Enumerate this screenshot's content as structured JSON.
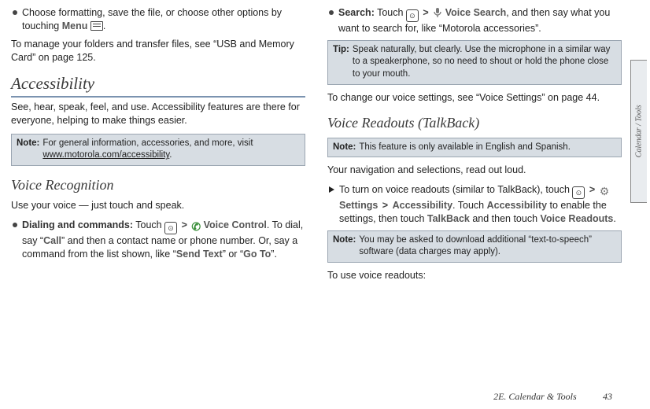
{
  "sideTab": "Calendar / Tools",
  "footer": {
    "section": "2E. Calendar & Tools",
    "page": "43"
  },
  "left": {
    "bullet1_a": "Choose formatting, save the file, or choose other options by touching ",
    "bullet1_menu": "Menu",
    "bullet1_b": ".",
    "para1": "To manage your folders and transfer files, see “USB and Memory Card” on page 125.",
    "h_access": "Accessibility",
    "access_intro": "See, hear, speak, feel, and use. Accessibility features are there for everyone, helping to make things easier.",
    "note1_label": "Note:",
    "note1_a": "For general information, accessories, and more, visit ",
    "note1_link": "www.motorola.com/accessibility",
    "note1_b": ".",
    "h_voice": "Voice Recognition",
    "voice_intro": "Use your voice — just touch and speak.",
    "dial_label": "Dialing and commands:",
    "dial_a": " Touch ",
    "dial_vc": "Voice Control",
    "dial_b": ". To dial, say “",
    "dial_call": "Call",
    "dial_c": "” and then a contact name or phone number. Or, say a command from the list shown, like “",
    "dial_send": "Send Text",
    "dial_d": "” or “",
    "dial_goto": "Go To",
    "dial_e": "”."
  },
  "right": {
    "search_label": "Search:",
    "search_a": " Touch ",
    "search_vs": "Voice Search",
    "search_b": ", and then say what you want to search for, like “Motorola accessories”.",
    "tip_label": "Tip:",
    "tip_text": "Speak naturally, but clearly. Use the microphone in a similar way to a speakerphone, so no need to shout or hold the phone close to your mouth.",
    "change_voice": "To change our voice settings, see “Voice Settings” on page 44.",
    "h_readouts": "Voice Readouts (TalkBack)",
    "note2_label": "Note:",
    "note2_text": "This feature is only available in English and Spanish.",
    "readouts_intro": "Your navigation and selections, read out loud.",
    "turn_a": "To turn on voice readouts (similar to TalkBack), touch ",
    "turn_settings": "Settings",
    "turn_access": "Accessibility",
    "turn_b": ". Touch ",
    "turn_access2": "Accessibility",
    "turn_c": " to enable the settings, then touch ",
    "turn_talkback": "TalkBack",
    "turn_d": " and then touch ",
    "turn_vr": "Voice Readouts",
    "turn_e": ".",
    "note3_label": "Note:",
    "note3_text": "You may be asked to download additional “text-to-speech” software (data charges may apply).",
    "use_readouts": "To use voice readouts:"
  }
}
